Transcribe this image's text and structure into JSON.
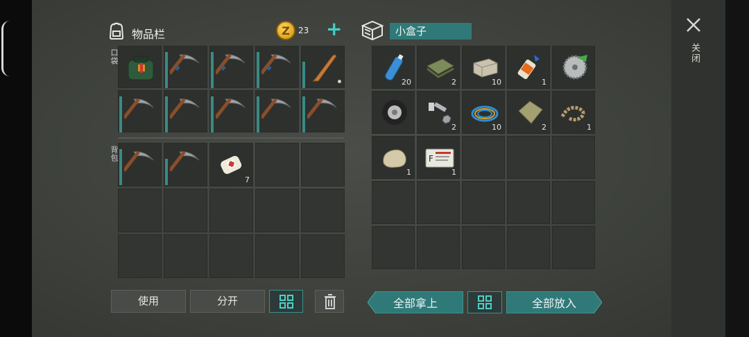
{
  "inventory": {
    "title": "物品栏",
    "coin_icon": "coin-icon",
    "coin_letter": "Z",
    "coins": "23",
    "add_icon": "+",
    "pocket_label": "口袋",
    "backpack_label": "背包",
    "pocket_items": [
      {
        "icon": "medkit-bag-icon",
        "count": ""
      },
      {
        "icon": "pickaxe-icon",
        "count": ""
      },
      {
        "icon": "pickaxe-icon",
        "count": ""
      },
      {
        "icon": "pickaxe-icon",
        "count": ""
      },
      {
        "icon": "baseball-bat-icon",
        "count": ""
      },
      {
        "icon": "pickaxe-icon",
        "count": ""
      },
      {
        "icon": "pickaxe-icon",
        "count": ""
      },
      {
        "icon": "pickaxe-icon",
        "count": ""
      },
      {
        "icon": "pickaxe-icon",
        "count": ""
      },
      {
        "icon": "pickaxe-icon",
        "count": ""
      }
    ],
    "backpack_items": [
      {
        "icon": "pickaxe-icon",
        "count": ""
      },
      {
        "icon": "pickaxe-icon",
        "count": ""
      },
      {
        "icon": "bandage-icon",
        "count": "7"
      }
    ],
    "buttons": {
      "use": "使用",
      "split": "分开",
      "sort_icon": "grid-sort-icon",
      "trash_icon": "trash-icon"
    }
  },
  "container": {
    "title": "小盒子",
    "items": [
      {
        "icon": "water-bottle-icon",
        "count": "20"
      },
      {
        "icon": "cloth-icon",
        "count": "2"
      },
      {
        "icon": "stone-block-icon",
        "count": "10"
      },
      {
        "icon": "glue-icon",
        "count": "1"
      },
      {
        "icon": "saw-blade-icon",
        "count": ""
      },
      {
        "icon": "tire-icon",
        "count": ""
      },
      {
        "icon": "bolt-nut-icon",
        "count": "2"
      },
      {
        "icon": "wire-coil-icon",
        "count": "10"
      },
      {
        "icon": "burlap-sack-icon",
        "count": "2"
      },
      {
        "icon": "rope-icon",
        "count": "1"
      },
      {
        "icon": "rock-icon",
        "count": "1"
      },
      {
        "icon": "id-card-icon",
        "count": "1"
      }
    ],
    "buttons": {
      "take_all": "全部拿上",
      "put_all": "全部放入",
      "sort_icon": "grid-sort-icon"
    }
  },
  "close": {
    "label": "关闭",
    "icon": "close-icon"
  },
  "colors": {
    "accent": "#3fd0c2",
    "teal": "#2f7a78",
    "slot": "#2d302d"
  }
}
